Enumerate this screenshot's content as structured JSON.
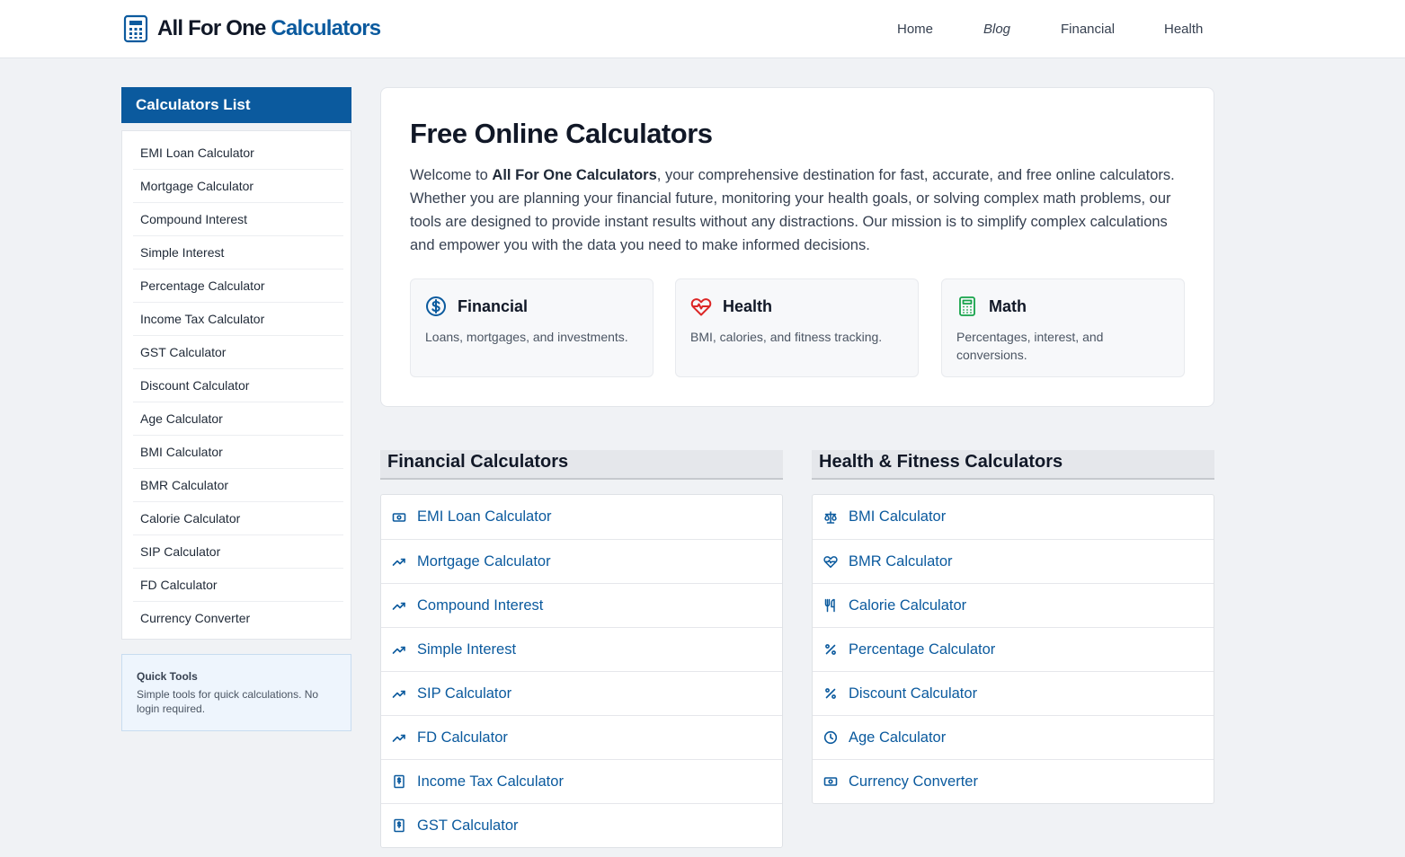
{
  "header": {
    "logo_text": "All For One",
    "logo_accent": "Calculators",
    "nav": [
      "Home",
      "Blog",
      "Financial",
      "Health"
    ]
  },
  "sidebar": {
    "title": "Calculators List",
    "items": [
      "EMI Loan Calculator",
      "Mortgage Calculator",
      "Compound Interest",
      "Simple Interest",
      "Percentage Calculator",
      "Income Tax Calculator",
      "GST Calculator",
      "Discount Calculator",
      "Age Calculator",
      "BMI Calculator",
      "BMR Calculator",
      "Calorie Calculator",
      "SIP Calculator",
      "FD Calculator",
      "Currency Converter"
    ],
    "quick_tools": {
      "title": "Quick Tools",
      "description": "Simple tools for quick calculations. No login required."
    }
  },
  "hero": {
    "title": "Free Online Calculators",
    "intro_prefix": "Welcome to ",
    "intro_brand": "All For One Calculators",
    "intro_rest": ", your comprehensive destination for fast, accurate, and free online calculators. Whether you are planning your financial future, monitoring your health goals, or solving complex math problems, our tools are designed to provide instant results without any distractions. Our mission is to simplify complex calculations and empower you with the data you need to make informed decisions.",
    "categories": [
      {
        "title": "Financial",
        "description": "Loans, mortgages, and investments.",
        "icon": "dollar-circle-icon",
        "color": "#0b5a9e"
      },
      {
        "title": "Health",
        "description": "BMI, calories, and fitness tracking.",
        "icon": "heart-pulse-icon",
        "color": "#dc2626"
      },
      {
        "title": "Math",
        "description": "Percentages, interest, and conversions.",
        "icon": "calculator-icon",
        "color": "#16a34a"
      }
    ]
  },
  "financial": {
    "title": "Financial Calculators",
    "items": [
      {
        "label": "EMI Loan Calculator",
        "icon": "banknote-icon"
      },
      {
        "label": "Mortgage Calculator",
        "icon": "trending-up-icon"
      },
      {
        "label": "Compound Interest",
        "icon": "trending-up-icon"
      },
      {
        "label": "Simple Interest",
        "icon": "trending-up-icon"
      },
      {
        "label": "SIP Calculator",
        "icon": "trending-up-icon"
      },
      {
        "label": "FD Calculator",
        "icon": "trending-up-icon"
      },
      {
        "label": "Income Tax Calculator",
        "icon": "receipt-icon"
      },
      {
        "label": "GST Calculator",
        "icon": "receipt-icon"
      }
    ]
  },
  "health": {
    "title": "Health & Fitness Calculators",
    "items": [
      {
        "label": "BMI Calculator",
        "icon": "scale-icon"
      },
      {
        "label": "BMR Calculator",
        "icon": "heart-pulse-icon"
      },
      {
        "label": "Calorie Calculator",
        "icon": "utensils-icon"
      },
      {
        "label": "Percentage Calculator",
        "icon": "percent-icon"
      },
      {
        "label": "Discount Calculator",
        "icon": "percent-icon"
      },
      {
        "label": "Age Calculator",
        "icon": "clock-icon"
      },
      {
        "label": "Currency Converter",
        "icon": "banknote-icon"
      }
    ]
  },
  "colors": {
    "brand": "#0b5a9e",
    "health": "#dc2626",
    "math": "#16a34a"
  }
}
